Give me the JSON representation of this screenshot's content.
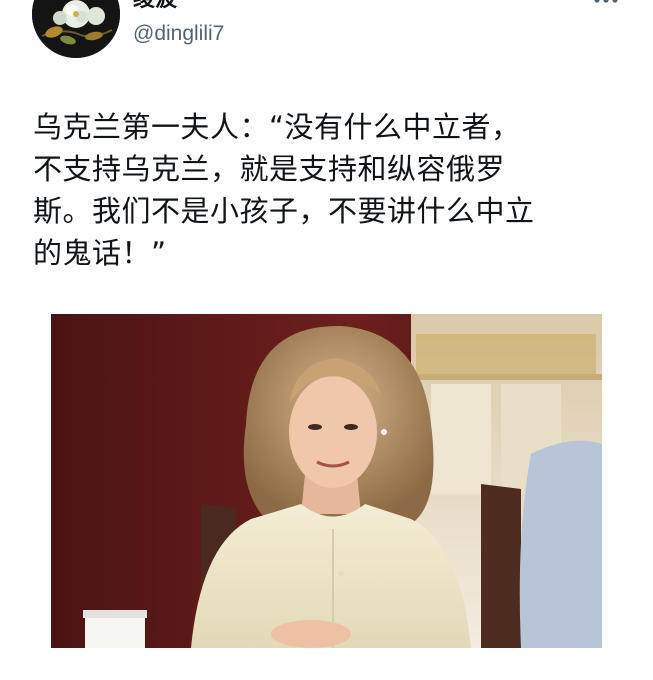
{
  "author": {
    "display_name": "绫波",
    "handle": "@dinglili7",
    "avatar_icon": "flower-avatar"
  },
  "more_icon": "more-horizontal-icon",
  "tweet": {
    "text": "乌克兰第一夫人：“没有什么中立者，\n不支持乌克兰，就是支持和纵容俄罗\n斯。我们不是小孩子，不要讲什么中立\n的鬼话！”"
  },
  "media": {
    "type": "photo",
    "subject": "woman-in-cream-jacket"
  },
  "colors": {
    "text": "#0f1419",
    "secondary_text": "#536471",
    "background": "#ffffff"
  }
}
